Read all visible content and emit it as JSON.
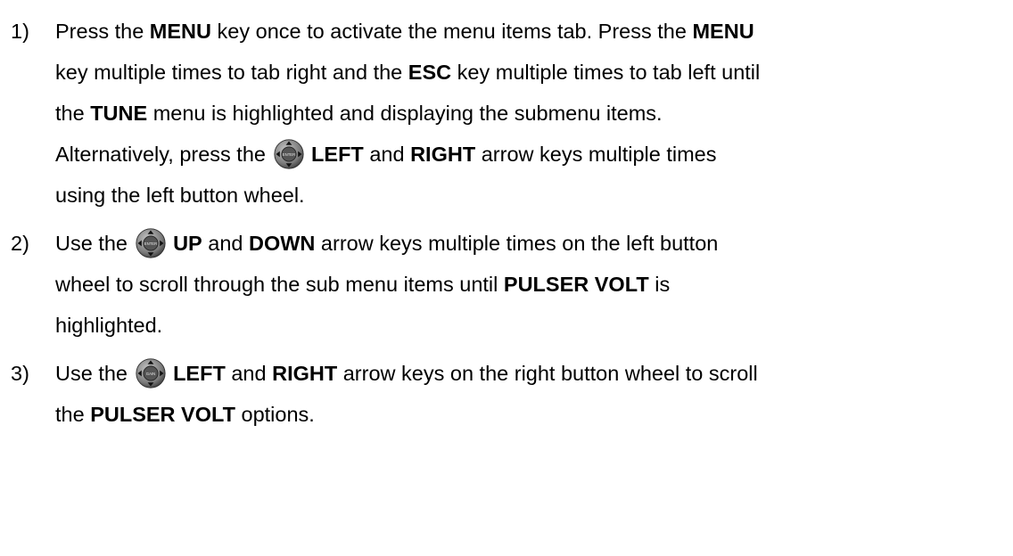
{
  "steps": [
    {
      "num": "1)",
      "lines": [
        [
          {
            "t": "Press the "
          },
          {
            "t": "MENU",
            "b": true
          },
          {
            "t": " key once to activate the menu items tab.  Press the "
          },
          {
            "t": "MENU",
            "b": true
          }
        ],
        [
          {
            "t": "key multiple times to tab right and the "
          },
          {
            "t": "ESC",
            "b": true
          },
          {
            "t": " key multiple times to tab left until"
          }
        ],
        [
          {
            "t": "the "
          },
          {
            "t": "TUNE",
            "b": true
          },
          {
            "t": " menu is highlighted and displaying the submenu items."
          }
        ],
        [
          {
            "t": "Alternatively, press the "
          },
          {
            "icon": "left-button-wheel-icon"
          },
          {
            "t": " "
          },
          {
            "t": "LEFT",
            "b": true
          },
          {
            "t": " and "
          },
          {
            "t": "RIGHT",
            "b": true
          },
          {
            "t": " arrow keys multiple times"
          }
        ],
        [
          {
            "t": "using the left button wheel."
          }
        ]
      ]
    },
    {
      "num": "2)",
      "lines": [
        [
          {
            "t": "Use the "
          },
          {
            "icon": "left-button-wheel-icon"
          },
          {
            "t": " "
          },
          {
            "t": "UP",
            "b": true
          },
          {
            "t": " and "
          },
          {
            "t": "DOWN",
            "b": true
          },
          {
            "t": " arrow keys multiple times on the left button"
          }
        ],
        [
          {
            "t": "wheel to scroll through the sub menu items until "
          },
          {
            "t": "PULSER VOLT",
            "b": true
          },
          {
            "t": " is"
          }
        ],
        [
          {
            "t": "highlighted."
          }
        ]
      ]
    },
    {
      "num": "3)",
      "lines": [
        [
          {
            "t": "Use the "
          },
          {
            "icon": "right-button-wheel-icon"
          },
          {
            "t": " "
          },
          {
            "t": "LEFT",
            "b": true
          },
          {
            "t": " and "
          },
          {
            "t": "RIGHT",
            "b": true
          },
          {
            "t": " arrow keys on the right button wheel to scroll"
          }
        ],
        [
          {
            "t": "the "
          },
          {
            "t": "PULSER VOLT",
            "b": true
          },
          {
            "t": " options."
          }
        ]
      ]
    }
  ],
  "icon_labels": {
    "left-button-wheel-icon": "ENTER",
    "right-button-wheel-icon": "GAIN"
  }
}
